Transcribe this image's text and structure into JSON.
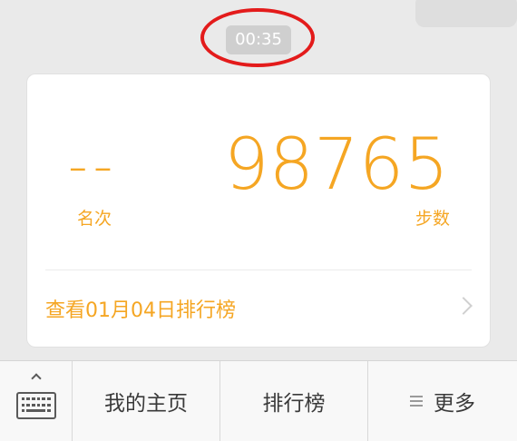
{
  "chat": {
    "timestamp": "00:35"
  },
  "card": {
    "rank_value": "--",
    "rank_label": "名次",
    "steps_value": "98765",
    "steps_label": "步数",
    "leaderboard_link": "查看01月04日排行榜"
  },
  "bottom_menu": {
    "keyboard_icon": "keyboard-icon",
    "items": [
      {
        "label": "我的主页"
      },
      {
        "label": "排行榜"
      },
      {
        "label": "更多",
        "icon": "hamburger-icon"
      }
    ]
  },
  "colors": {
    "accent": "#f5a623",
    "highlight_circle": "#e31b1b"
  }
}
